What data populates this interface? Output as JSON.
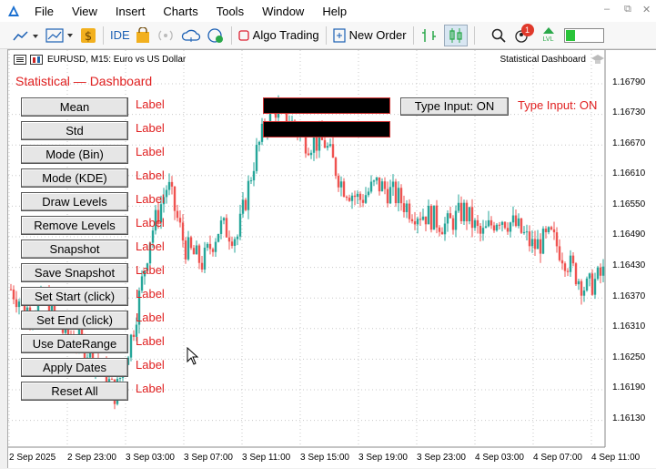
{
  "menu": {
    "items": [
      "File",
      "View",
      "Insert",
      "Charts",
      "Tools",
      "Window",
      "Help"
    ]
  },
  "toolbar": {
    "ide_label": "IDE",
    "algo_trading_label": "Algo Trading",
    "new_order_label": "New Order",
    "notification_count": "1",
    "lvl_label": "LVL"
  },
  "chart": {
    "header": "EURUSD, M15:  Euro vs US Dollar",
    "ea_name": "Statistical Dashboard",
    "price_ticks": [
      "1.16790",
      "1.16730",
      "1.16670",
      "1.16610",
      "1.16550",
      "1.16490",
      "1.16430",
      "1.16370",
      "1.16310",
      "1.16250",
      "1.16190",
      "1.16130"
    ],
    "time_ticks": [
      "2 Sep 2025",
      "2 Sep 23:00",
      "3 Sep 03:00",
      "3 Sep 07:00",
      "3 Sep 11:00",
      "3 Sep 15:00",
      "3 Sep 19:00",
      "3 Sep 23:00",
      "4 Sep 03:00",
      "4 Sep 07:00",
      "4 Sep 11:00"
    ],
    "bull_color": "#26a69a",
    "bear_color": "#ef5350"
  },
  "dashboard": {
    "title": "Statistical — Dashboard",
    "buttons": [
      {
        "label": "Mean",
        "value": "Label"
      },
      {
        "label": "Std",
        "value": "Label"
      },
      {
        "label": "Mode (Bin)",
        "value": "Label"
      },
      {
        "label": "Mode (KDE)",
        "value": "Label"
      },
      {
        "label": "Draw Levels",
        "value": "Label"
      },
      {
        "label": "Remove Levels",
        "value": "Label"
      },
      {
        "label": "Snapshot",
        "value": "Label"
      },
      {
        "label": "Save Snapshot",
        "value": "Label"
      },
      {
        "label": "Set Start (click)",
        "value": "Label"
      },
      {
        "label": "Set End (click)",
        "value": "Label"
      },
      {
        "label": "Use DateRange",
        "value": "Label"
      },
      {
        "label": "Apply Dates",
        "value": "Label"
      },
      {
        "label": "Reset All",
        "value": "Label"
      }
    ],
    "type_button_label": "Type Input: ON",
    "type_status": "Type Input: ON"
  },
  "chart_data": {
    "type": "candlestick",
    "symbol": "EURUSD",
    "timeframe": "M15",
    "y_range": [
      1.161,
      1.1682
    ],
    "approx_close_path": [
      1.164,
      1.1636,
      1.1638,
      1.1632,
      1.163,
      1.1626,
      1.162,
      1.1632,
      1.165,
      1.166,
      1.1648,
      1.1645,
      1.1652,
      1.165,
      1.1665,
      1.1675,
      1.1672,
      1.1668,
      1.1668,
      1.166,
      1.1657,
      1.166,
      1.1658,
      1.1655,
      1.1654,
      1.1652,
      1.1655,
      1.165,
      1.1654,
      1.1652,
      1.1648,
      1.165,
      1.1645,
      1.164,
      1.1643
    ]
  }
}
